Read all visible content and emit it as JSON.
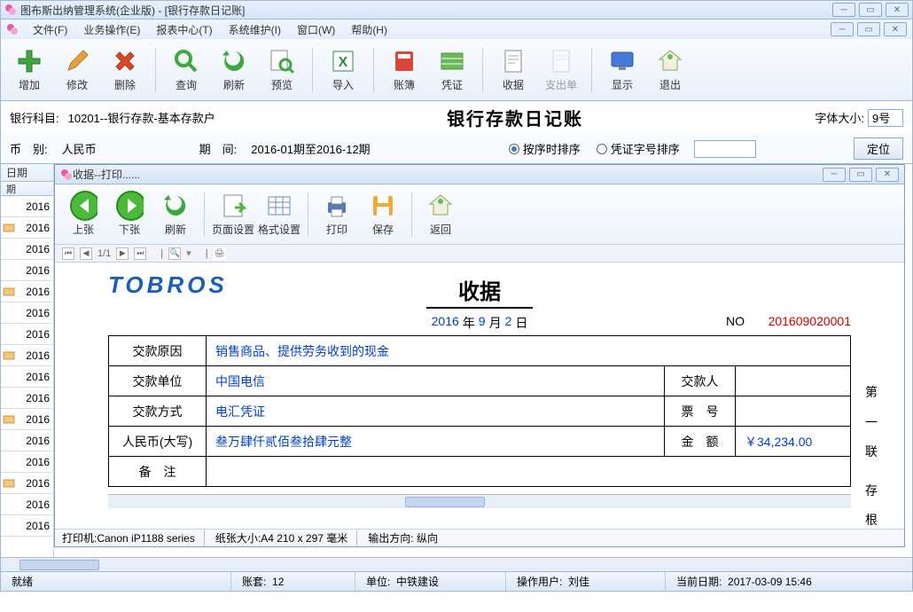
{
  "window": {
    "title": "图布斯出纳管理系统(企业版) - [银行存款日记账]"
  },
  "menu": {
    "file": "文件(F)",
    "biz": "业务操作(E)",
    "report": "报表中心(T)",
    "sys": "系统维护(I)",
    "window": "窗口(W)",
    "help": "帮助(H)"
  },
  "toolbar": {
    "add": "增加",
    "edit": "修改",
    "delete": "删除",
    "query": "查询",
    "refresh": "刷新",
    "preview": "预览",
    "import": "导入",
    "ledger": "账簿",
    "voucher": "凭证",
    "receipt": "收据",
    "expense": "支出单",
    "display": "显示",
    "exit": "退出"
  },
  "info": {
    "bank_subject_label": "银行科目:",
    "bank_subject_value": "10201--银行存款-基本存款户",
    "page_title": "银行存款日记账",
    "fontsize_label": "字体大小:",
    "fontsize_value": "9号",
    "currency_label": "币　别:",
    "currency_value": "人民币",
    "period_label": "期　间:",
    "period_value": "2016-01期至2016-12期",
    "sort_seq": "按序时排序",
    "sort_no": "凭证字号排序",
    "locate": "定位"
  },
  "grid": {
    "date_header": "日期",
    "curr_header": "期",
    "rows": [
      "2016",
      "2016",
      "2016",
      "2016",
      "2016",
      "2016",
      "2016",
      "2016",
      "2016",
      "2016",
      "2016",
      "2016",
      "2016",
      "2016",
      "2016",
      "2016"
    ]
  },
  "print": {
    "title": "收据--打印......",
    "tb": {
      "prev": "上张",
      "next": "下张",
      "refresh": "刷新",
      "page_setup": "页面设置",
      "format": "格式设置",
      "print": "打印",
      "save": "保存",
      "back": "返回"
    },
    "nav": {
      "page": "1/1"
    },
    "logo": "TOBROS",
    "doc_title": "收据",
    "date": {
      "year": "2016",
      "y_lbl": "年",
      "month": "9",
      "m_lbl": "月",
      "day": "2",
      "d_lbl": "日"
    },
    "no_label": "NO",
    "no_value": "201609020001",
    "rows": {
      "reason_lbl": "交款原因",
      "reason_val": "销售商品、提供劳务收到的现金",
      "payer_unit_lbl": "交款单位",
      "payer_unit_val": "中国电信",
      "payer_lbl": "交款人",
      "method_lbl": "交款方式",
      "method_val": "电汇凭证",
      "ticket_lbl": "票　号",
      "rmb_lbl": "人民币(大写)",
      "rmb_val": "叁万肆仟贰佰叁拾肆元整",
      "amount_lbl": "金　额",
      "amount_val": "￥34,234.00",
      "remark_lbl": "备　注"
    },
    "side": {
      "a": "第",
      "b": "一",
      "c": "联",
      "d": "存",
      "e": "根"
    },
    "status": {
      "printer_lbl": "打印机:",
      "printer_val": "Canon iP1188 series",
      "paper_lbl": "纸张大小:",
      "paper_val": "A4 210 x 297 毫米",
      "orient_lbl": "输出方向:",
      "orient_val": "纵向"
    }
  },
  "statusbar": {
    "ready": "就绪",
    "book_lbl": "账套:",
    "book_val": "12",
    "unit_lbl": "单位:",
    "unit_val": "中铁建设",
    "user_lbl": "操作用户:",
    "user_val": "刘佳",
    "date_lbl": "当前日期:",
    "date_val": "2017-03-09 15:46"
  }
}
